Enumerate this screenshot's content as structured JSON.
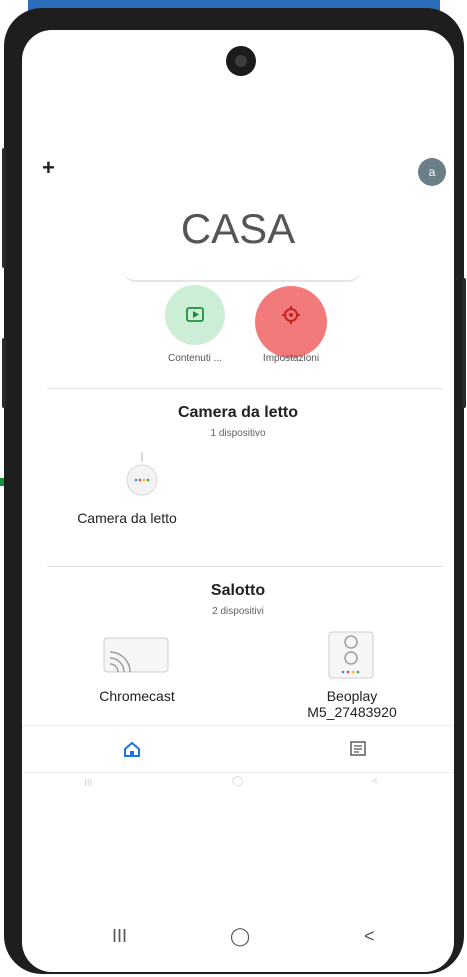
{
  "header": {
    "add_icon": "plus-icon",
    "add_label": "+",
    "avatar_letter": "a"
  },
  "home": {
    "title": "CASA"
  },
  "actions": [
    {
      "label": "Contenuti ...",
      "icon": "play-icon",
      "color": "#cdeed6",
      "icon_color": "#1e8e3e"
    },
    {
      "label": "Impostazioni",
      "icon": "gear-icon",
      "color": "#f5c7c7",
      "icon_color": "#c5221f"
    }
  ],
  "rooms": [
    {
      "name": "Camera da letto",
      "count": "1 dispositivo",
      "devices": [
        {
          "name": "Camera da letto",
          "icon": "speaker-mini-icon"
        }
      ]
    },
    {
      "name": "Salotto",
      "count": "2 dispositivi",
      "devices": [
        {
          "name": "Chromecast",
          "icon": "chromecast-icon"
        },
        {
          "name": "Beoplay M5_27483920",
          "name_line1": "Beoplay",
          "name_line2": "M5_27483920",
          "icon": "speaker-icon"
        }
      ]
    }
  ],
  "bottom_nav": {
    "home_icon": "home-icon",
    "feed_icon": "feed-icon"
  },
  "system_nav": {
    "recents": "III",
    "home": "◯",
    "back": "<"
  },
  "colors": {
    "accent": "#1a73e8",
    "highlight": "#f26b6b",
    "avatar": "#6b7f88"
  }
}
